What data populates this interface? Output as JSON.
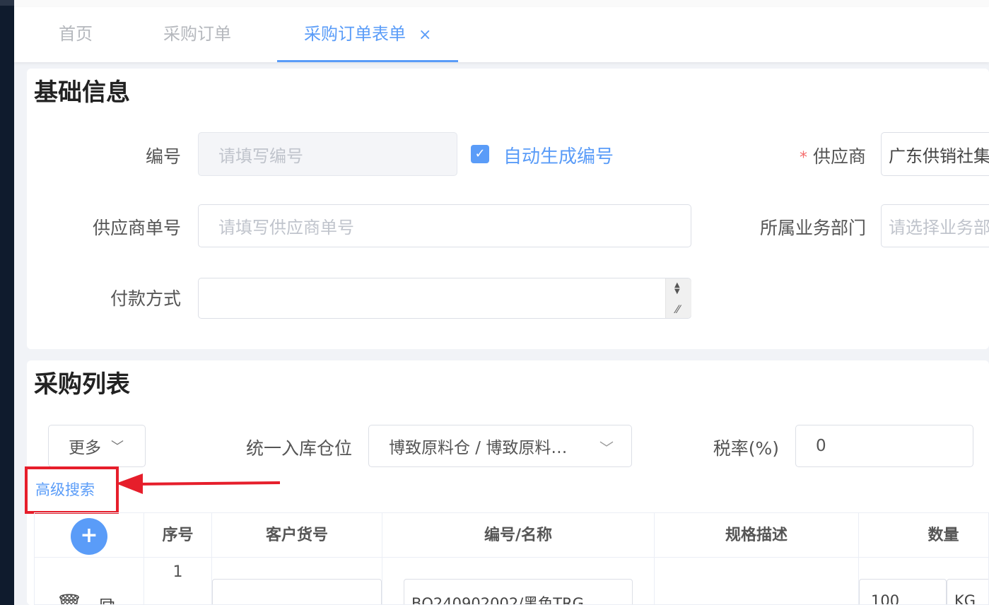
{
  "tabs": [
    {
      "label": "首页",
      "active": false
    },
    {
      "label": "采购订单",
      "active": false
    },
    {
      "label": "采购订单表单",
      "active": true,
      "close": "×"
    }
  ],
  "basic_info": {
    "title": "基础信息",
    "code_label": "编号",
    "code_placeholder": "请填写编号",
    "auto_code_checked": true,
    "auto_code_label": "自动生成编号",
    "supplier_required": "*",
    "supplier_label": "供应商",
    "supplier_value": "广东供销社集",
    "supplier_no_label": "供应商单号",
    "supplier_no_placeholder": "请填写供应商单号",
    "dept_label": "所属业务部门",
    "dept_placeholder": "请选择业务部",
    "payment_label": "付款方式",
    "payment_value": ""
  },
  "purchase_list": {
    "title": "采购列表",
    "more_label": "更多",
    "warehouse_label": "统一入库仓位",
    "warehouse_value": "博致原料仓 / 博致原料…",
    "tax_label": "税率(%)",
    "tax_value": "0",
    "advanced_search": "高级搜索",
    "add_icon": "+",
    "columns": [
      "序号",
      "客户货号",
      "编号/名称",
      "规格描述",
      "数量"
    ],
    "rows": [
      {
        "index": "1",
        "customer_no": "",
        "code_name": "BQ240902002/黑色TRG",
        "spec": "",
        "qty": "100",
        "unit": "KG"
      }
    ]
  },
  "colors": {
    "accent": "#5a9cf8",
    "annotation": "#e61e2b",
    "required": "#f56c6c"
  }
}
